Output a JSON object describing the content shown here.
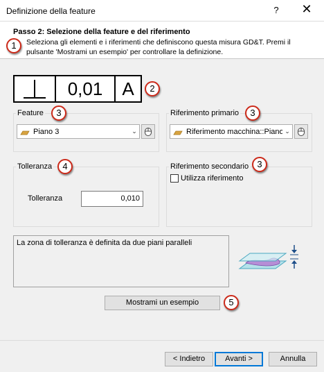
{
  "window": {
    "title": "Definizione della feature",
    "help": "?",
    "close": "✕"
  },
  "header": {
    "step_title": "Passo 2: Selezione della feature e del riferimento",
    "step_desc": "Seleziona gli elementi e i riferimenti che definiscono questa misura GD&T. Premi il pulsante 'Mostrami un esempio' per controllare la definizione."
  },
  "frame": {
    "symbol": "⊥",
    "tolerance": "0,01",
    "datum": "A"
  },
  "feature": {
    "label": "Feature",
    "value": "Piano 3"
  },
  "primary_ref": {
    "label": "Riferimento primario",
    "value": "Riferimento macchina::Piano X"
  },
  "tolerance_group": {
    "label": "Tolleranza",
    "field_label": "Tolleranza",
    "value": "0,010"
  },
  "secondary_ref": {
    "label": "Riferimento secondario",
    "checkbox_label": "Utilizza riferimento",
    "checked": false
  },
  "description": "La zona di tolleranza è definita da due piani paralleli",
  "buttons": {
    "show_example": "Mostrami un esempio",
    "back": "< Indietro",
    "next": "Avanti >",
    "cancel": "Annulla"
  },
  "badges": {
    "b1": "1",
    "b2": "2",
    "b3a": "3",
    "b3b": "3",
    "b3c": "3",
    "b4": "4",
    "b5": "5"
  },
  "colors": {
    "badge_border": "#cc2a1a",
    "default_button_border": "#0078d7",
    "plane_icon": "#d9a441"
  }
}
